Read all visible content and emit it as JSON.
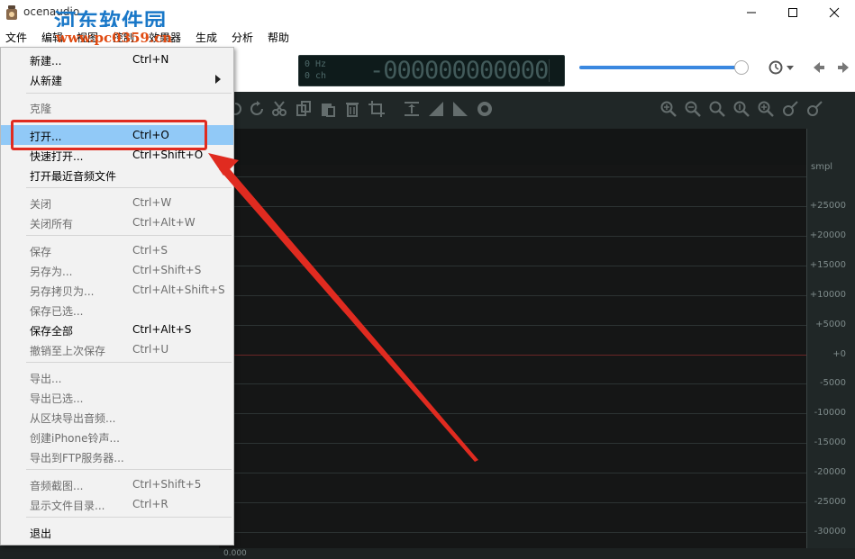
{
  "window": {
    "title": "ocenaudio"
  },
  "watermark": {
    "text": "河东软件园",
    "url": "www.pc0359.cn"
  },
  "menubar": [
    {
      "label": "文件"
    },
    {
      "label": "编辑"
    },
    {
      "label": "视图"
    },
    {
      "label": "控制"
    },
    {
      "label": "效果器"
    },
    {
      "label": "生成"
    },
    {
      "label": "分析"
    },
    {
      "label": "帮助"
    }
  ],
  "display": {
    "hz": "0 Hz",
    "ch": "0 ch",
    "time": "-000000000000"
  },
  "volume": {
    "level_percent": 96
  },
  "file_menu": {
    "groups": [
      [
        {
          "label": "新建...",
          "shortcut": "Ctrl+N",
          "enabled": true
        },
        {
          "label": "从新建",
          "shortcut": "",
          "enabled": true,
          "submenu": true
        }
      ],
      [
        {
          "label": "克隆",
          "shortcut": "",
          "enabled": false
        },
        {
          "label": "打开...",
          "shortcut": "Ctrl+O",
          "enabled": true,
          "highlighted": true
        },
        {
          "label": "快速打开...",
          "shortcut": "Ctrl+Shift+O",
          "enabled": true
        },
        {
          "label": "打开最近音频文件",
          "shortcut": "",
          "enabled": true
        }
      ],
      [
        {
          "label": "关闭",
          "shortcut": "Ctrl+W",
          "enabled": false
        },
        {
          "label": "关闭所有",
          "shortcut": "Ctrl+Alt+W",
          "enabled": false
        }
      ],
      [
        {
          "label": "保存",
          "shortcut": "Ctrl+S",
          "enabled": false
        },
        {
          "label": "另存为...",
          "shortcut": "Ctrl+Shift+S",
          "enabled": false
        },
        {
          "label": "另存拷贝为...",
          "shortcut": "Ctrl+Alt+Shift+S",
          "enabled": false
        },
        {
          "label": "保存已选...",
          "shortcut": "",
          "enabled": false
        },
        {
          "label": "保存全部",
          "shortcut": "Ctrl+Alt+S",
          "enabled": true
        },
        {
          "label": "撤销至上次保存",
          "shortcut": "Ctrl+U",
          "enabled": false
        }
      ],
      [
        {
          "label": "导出...",
          "shortcut": "",
          "enabled": false
        },
        {
          "label": "导出已选...",
          "shortcut": "",
          "enabled": false
        },
        {
          "label": "从区块导出音频...",
          "shortcut": "",
          "enabled": false
        },
        {
          "label": "创建iPhone铃声...",
          "shortcut": "",
          "enabled": false
        },
        {
          "label": "导出到FTP服务器...",
          "shortcut": "",
          "enabled": false
        }
      ],
      [
        {
          "label": "音频截图...",
          "shortcut": "Ctrl+Shift+5",
          "enabled": false
        },
        {
          "label": "显示文件目录...",
          "shortcut": "Ctrl+R",
          "enabled": false
        }
      ],
      [
        {
          "label": "退出",
          "shortcut": "",
          "enabled": true
        }
      ]
    ]
  },
  "ruler": {
    "unit": "smpl",
    "labels": [
      "+25000",
      "+20000",
      "+15000",
      "+10000",
      "+5000",
      "+0",
      "-5000",
      "-10000",
      "-15000",
      "-20000",
      "-25000",
      "-30000"
    ]
  },
  "bottom": {
    "position": "0.000"
  },
  "colors": {
    "highlight": "#91c9f7",
    "annotation": "#e02b20",
    "waveform_bg": "#151616",
    "accent": "#3a88e0"
  }
}
